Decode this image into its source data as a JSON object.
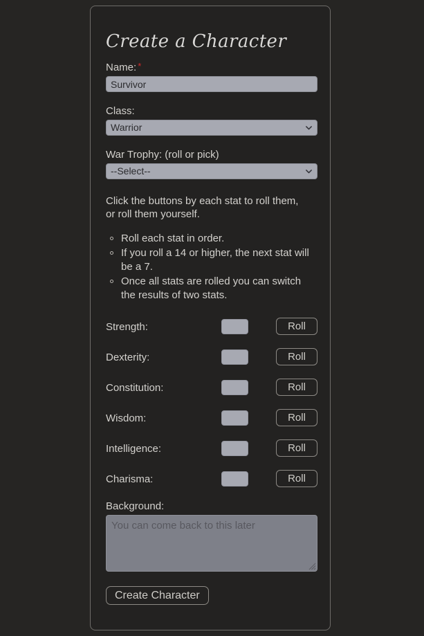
{
  "page": {
    "background_color": "#262523",
    "panel_color": "#232221",
    "panel_border_color": "#6e6c69",
    "text_color": "#d3d1cd",
    "required_marker_color": "#d22b2b",
    "input_fill_color": "#a7a9b2",
    "textarea_fill_color": "#7e8089"
  },
  "form": {
    "title": "Create a Character",
    "name": {
      "label": "Name:",
      "required_marker": "*",
      "value": "Survivor",
      "placeholder": ""
    },
    "class": {
      "label": "Class:",
      "selected": "Warrior",
      "arrow_icon": "chevron-down-icon"
    },
    "war_trophy": {
      "label": "War Trophy: (roll or pick)",
      "selected": "--Select--",
      "arrow_icon": "chevron-down-icon"
    },
    "instructions": {
      "intro": "Click the buttons by each stat to roll them, or roll them yourself.",
      "rules": [
        "Roll each stat in order.",
        "If you roll a 14 or higher, the next stat will be a 7.",
        "Once all stats are rolled you can switch the results of two stats."
      ]
    },
    "stats": {
      "roll_button_label": "Roll",
      "rows": [
        {
          "label": "Strength:",
          "value": ""
        },
        {
          "label": "Dexterity:",
          "value": ""
        },
        {
          "label": "Constitution:",
          "value": ""
        },
        {
          "label": "Wisdom:",
          "value": ""
        },
        {
          "label": "Intelligence:",
          "value": ""
        },
        {
          "label": "Charisma:",
          "value": ""
        }
      ]
    },
    "background": {
      "label": "Background:",
      "placeholder": "You can come back to this later",
      "value": "",
      "resize_handle_icon": "resize-grip-icon"
    },
    "submit": {
      "label": "Create Character"
    }
  }
}
